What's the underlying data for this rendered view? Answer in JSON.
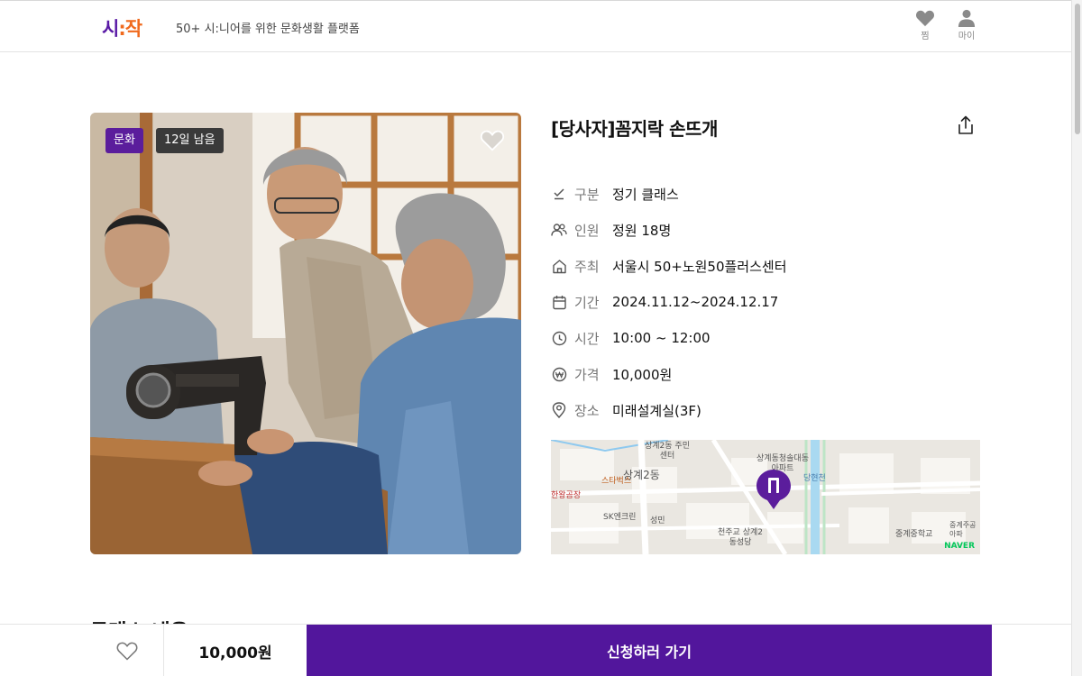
{
  "header": {
    "logo_part1": "시",
    "logo_part2": ":작",
    "tagline": "50+ 시:니어를 위한 문화생활 플랫폼",
    "wishlist_label": "찜",
    "my_label": "마이"
  },
  "photo": {
    "category_badge": "문화",
    "days_left_badge": "12일 남음"
  },
  "program": {
    "title": "[당사자]꼼지락 손뜨개",
    "details": [
      {
        "icon": "check-icon",
        "label": "구분",
        "value": "정기 클래스"
      },
      {
        "icon": "people-icon",
        "label": "인원",
        "value": "정원 18명"
      },
      {
        "icon": "home-icon",
        "label": "주최",
        "value": "서울시 50+노원50플러스센터"
      },
      {
        "icon": "calendar-icon",
        "label": "기간",
        "value": "2024.11.12~2024.12.17"
      },
      {
        "icon": "clock-icon",
        "label": "시간",
        "value": "10:00 ~ 12:00"
      },
      {
        "icon": "won-icon",
        "label": "가격",
        "value": "10,000원"
      },
      {
        "icon": "location-pin-icon",
        "label": "장소",
        "value": "미래설계실(3F)"
      }
    ]
  },
  "map": {
    "labels": [
      "상계2동 주민센터",
      "상계2동",
      "스타벅스",
      "상계동청솔대동 아파트",
      "SK엔크린",
      "성민",
      "당현천",
      "천주교 상계2동성당",
      "중계중학교",
      "중계주공 아파",
      "한왕곰장"
    ],
    "provider": "NAVER"
  },
  "section_peek": "클래스 내용",
  "bottom_bar": {
    "price": "10,000원",
    "apply_label": "신청하러 가기"
  },
  "colors": {
    "brand_purple": "#52169c",
    "brand_orange": "#f06a1d",
    "badge_dark": "#3a3a3a"
  }
}
